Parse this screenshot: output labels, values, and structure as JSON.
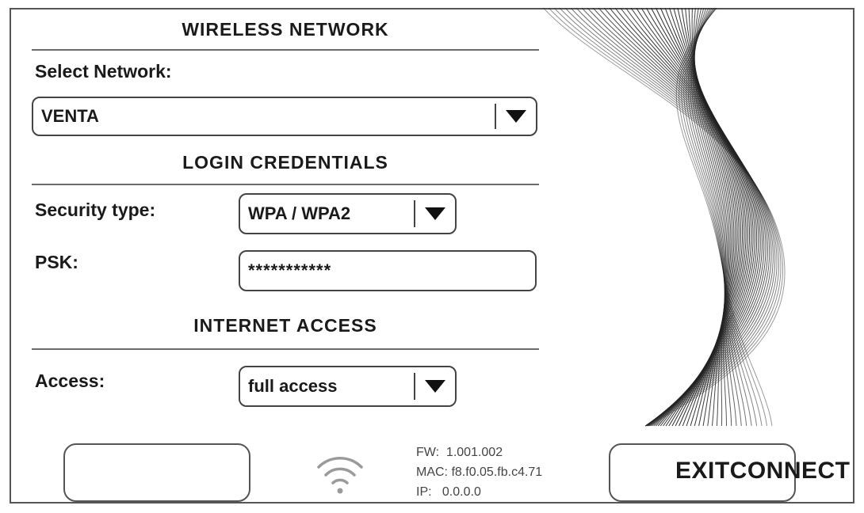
{
  "sections": {
    "wireless": "WIRELESS NETWORK",
    "login": "LOGIN CREDENTIALS",
    "internet": "INTERNET ACCESS"
  },
  "network": {
    "label": "Select Network:",
    "value": "VENTA"
  },
  "security": {
    "label": "Security type:",
    "value": "WPA / WPA2"
  },
  "psk": {
    "label": "PSK:",
    "value": "***********"
  },
  "access": {
    "label": "Access:",
    "value": "full access"
  },
  "device_info": {
    "fw_label": "FW:",
    "fw_value": "1.001.002",
    "mac_label": "MAC:",
    "mac_value": "f8.f0.05.fb.c4.71",
    "ip_label": "IP:",
    "ip_value": "0.0.0.0"
  },
  "buttons": {
    "exit_connect": "EXITCONNECT"
  },
  "icons": {
    "dropdown": "triangle-down-icon",
    "wifi": "wifi-icon"
  }
}
